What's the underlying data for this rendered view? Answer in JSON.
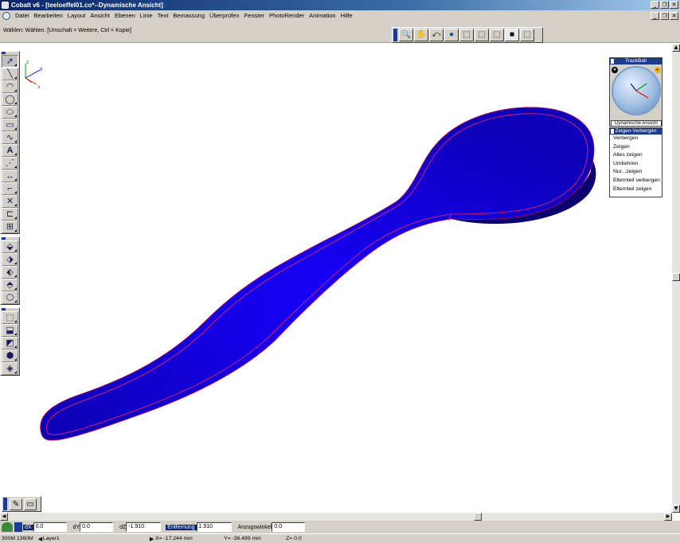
{
  "window": {
    "title": "Cobalt v6 - [teeloeffel01.co*--Dynamische Ansicht]"
  },
  "menu": {
    "items": [
      "Datei",
      "Bearbeiten",
      "Layout",
      "Ansicht",
      "Ebenen",
      "Linie",
      "Text",
      "Bemassung",
      "Überprüfen",
      "Fenster",
      "PhotoRender",
      "Animation",
      "Hilfe"
    ]
  },
  "prompt": {
    "text": "Wählen: Wählen. [Umschalt = Weitere, Ctrl = Kopie]"
  },
  "view_toolbar": {
    "icons": [
      "zoom-icon",
      "pan-hand-icon",
      "orbit-icon",
      "render-sphere-icon",
      "view-top-icon",
      "view-front-icon",
      "view-side-icon",
      "view-shaded-icon",
      "view-iso-icon"
    ]
  },
  "trackball_panel": {
    "title": "TrackBall",
    "mode_label": "Dynamische Ansicht"
  },
  "show_hide_panel": {
    "title": "Zeigen-Verbergen",
    "items": [
      "Verbergen",
      "Zeigen",
      "Alles zeigen",
      "Umkehren",
      "Nur...zeigen",
      "Elternteil verbergen",
      "Elternteil zeigen"
    ]
  },
  "input_bar": {
    "dx_label": "dX",
    "dx_value": "0.0",
    "dy_label": "dY",
    "dy_value": "0.0",
    "dz_label": "dZ",
    "dz_value": "-1.910",
    "distance_label": "Entfernung",
    "distance_value": "1.910",
    "draft_angle_label": "Anzugswinkel",
    "draft_angle_value": "0.0"
  },
  "status_bar": {
    "memory": "300M 1360M",
    "layer": "Layer1",
    "x": "X=   -17.244 mm",
    "y": "Y=   -36.499 mm",
    "z": "Z=       0.0"
  },
  "colors": {
    "spoon_fill": "#1400e6",
    "spoon_outline": "#ff0066",
    "title_bar": "#0a246a"
  }
}
